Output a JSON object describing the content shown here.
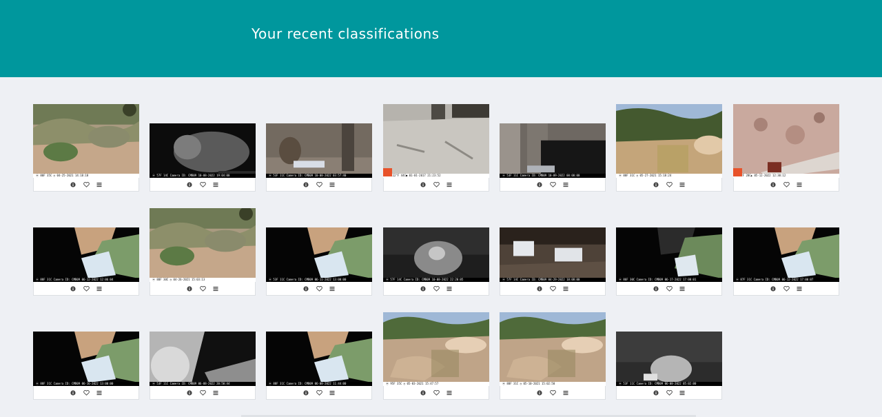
{
  "page_title": "Your recent classifications",
  "colors": {
    "banner": "#00979d",
    "background": "#eef0f4"
  },
  "card_actions": [
    "info-icon",
    "heart-icon",
    "list-icon"
  ],
  "classifications": [
    {
      "scene": "desert",
      "stamp": "⦿ 80F 35C ◷   04-25-2021 14:18:18",
      "light": true
    },
    {
      "scene": "night_bobcat",
      "stamp": "⦿ 57F 14C   Camera ID: CMB09   10-08-2022 19:04:00"
    },
    {
      "scene": "fence_bobcat",
      "stamp": "⦿ 53F 11C   Camera ID: CMB09   10-08-2022 03:57:40"
    },
    {
      "scene": "debris",
      "stamp": "11   112°F 44C●   01-01-2017  21:23:52",
      "light": true,
      "logo": true
    },
    {
      "scene": "fence_dark",
      "stamp": "⦿ 53F 11C   Camera ID: CMB09   10-09-2022 00:00:00"
    },
    {
      "scene": "shrub_rocks",
      "stamp": "⦿ 88F 31C ◷   05-27-2021 15:18:24",
      "light": true
    },
    {
      "scene": "rock",
      "stamp": "8   82F 28C◐   05-12-2022   12:30:12",
      "light": true,
      "logo": true
    },
    {
      "scene": "tilted",
      "stamp": "⦿ 88F 31C   Camera ID: CMB09   06-12-2022 12:06:04"
    },
    {
      "scene": "desert",
      "stamp": "⦿ 88F 30C ◷   04-26-2021 15:03:13",
      "light": true
    },
    {
      "scene": "tilted",
      "stamp": "⦿ 53F 11C   Camera ID: CMB09   06-11-2022 13:00:00"
    },
    {
      "scene": "night_fox",
      "stamp": "⦿ 57F 14C   Camera ID: CMB09   10-08-2022 22:20:05"
    },
    {
      "scene": "debris_night",
      "stamp": "⦿ 57F 14C   Camera ID: CMB09   04-29-2022 18:08:00"
    },
    {
      "scene": "tilted_dark",
      "stamp": "⦿ 86F 30C   Camera ID: CMB09   06-17-2022 17:00:01"
    },
    {
      "scene": "tilted",
      "stamp": "⦿ 87F 31C   Camera ID: CMB09   06-12-2022 17:00:07"
    },
    {
      "scene": "tilted",
      "stamp": "⦿ 88F 31C   Camera ID: CMB09   06-16-2022 13:00:00"
    },
    {
      "scene": "cave",
      "stamp": "⦿ 53F 11C   Camera ID: CMB09   06-08-2022 20:50:44"
    },
    {
      "scene": "tilted",
      "stamp": "⦿ 88F 31C   Camera ID: CMB09   06-08-2022 11:44:00"
    },
    {
      "scene": "canyon",
      "stamp": "⦿ 95F 35C ◷   05-03-2021 15:47:57",
      "light": true
    },
    {
      "scene": "canyon",
      "stamp": "⦿ 88F 31C ◷   05-10-2021 15:02:50",
      "light": true
    },
    {
      "scene": "night_cat",
      "stamp": "⦿ 53F 11C   Camera ID: CMB09   06-08-2022 05:02:00"
    }
  ]
}
